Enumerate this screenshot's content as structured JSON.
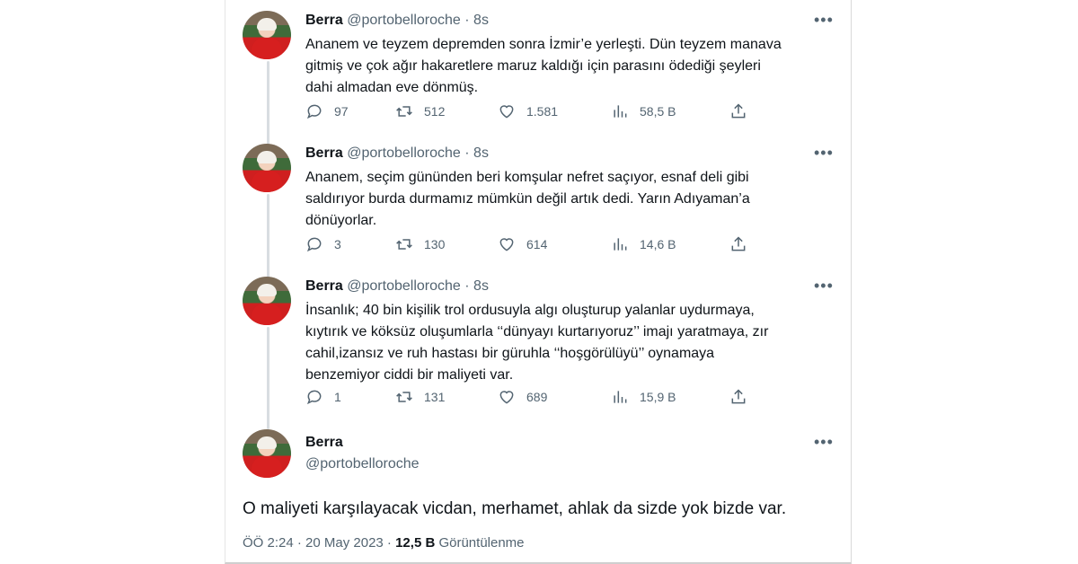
{
  "tweets": [
    {
      "name": "Berra",
      "handle": "@portobelloroche",
      "time": "8s",
      "lines": [
        "Ananem ve teyzem depremden sonra İzmir’e yerleşti. Dün teyzem manava",
        "gitmiş ve çok ağır hakaretlere maruz kaldığı için parasını ödediği şeyleri",
        "dahi almadan eve dönmüş."
      ],
      "replies": "97",
      "retweets": "512",
      "likes": "1.581",
      "views": "58,5 B"
    },
    {
      "name": "Berra",
      "handle": "@portobelloroche",
      "time": "8s",
      "lines": [
        "Ananem, seçim gününden beri komşular nefret saçıyor, esnaf deli gibi",
        "saldırıyor burda durmamız mümkün değil artık dedi. Yarın Adıyaman’a",
        "dönüyorlar."
      ],
      "replies": "3",
      "retweets": "130",
      "likes": "614",
      "views": "14,6 B"
    },
    {
      "name": "Berra",
      "handle": "@portobelloroche",
      "time": "8s",
      "lines": [
        "İnsanlık; 40 bin kişilik trol ordusuyla algı oluşturup yalanlar uydurmaya,",
        "kıytırık ve köksüz oluşumlarla ‘‘dünyayı kurtarıyoruz’’ imajı yaratmaya, zır",
        "cahil,izansız ve  ruh hastası bir güruhla ‘‘hoşgörülüyü’’ oynamaya",
        "benzemiyor ciddi bir maliyeti var."
      ],
      "replies": "1",
      "retweets": "131",
      "likes": "689",
      "views": "15,9 B"
    }
  ],
  "focus": {
    "name": "Berra",
    "handle": "@portobelloroche",
    "text": "O maliyeti karşılayacak vicdan, merhamet, ahlak da sizde yok bizde var.",
    "timestamp": "ÖÖ 2:24 · 20 May 2023 · ",
    "views": "12,5 B",
    "views_label": " Görüntülenme"
  },
  "more_label": "•••",
  "icons": [
    "reply-icon",
    "retweet-icon",
    "like-icon",
    "views-icon",
    "share-icon"
  ]
}
